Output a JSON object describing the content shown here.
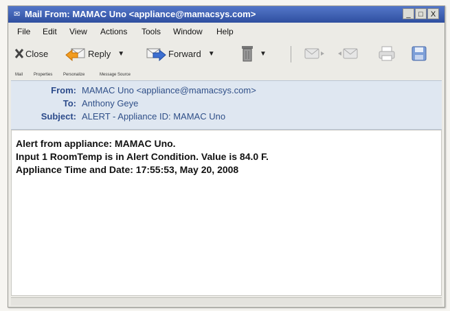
{
  "window": {
    "title": "Mail From: MAMAC Uno <appliance@mamacsys.com>"
  },
  "window_controls": {
    "minimize": "_",
    "maximize": "□",
    "close": "X"
  },
  "menu": [
    "File",
    "Edit",
    "View",
    "Actions",
    "Tools",
    "Window",
    "Help"
  ],
  "toolbar": {
    "close_label": "Close",
    "reply_label": "Reply",
    "forward_label": "Forward"
  },
  "tabs": [
    "Mail",
    "Properties",
    "Personalize",
    "Message Source"
  ],
  "header": {
    "from_label": "From:",
    "from_value": "MAMAC Uno <appliance@mamacsys.com>",
    "to_label": "To:",
    "to_value": "Anthony Geye",
    "subject_label": "Subject:",
    "subject_value": "ALERT - Appliance ID: MAMAC Uno"
  },
  "body": {
    "lines": [
      "Alert from appliance: MAMAC Uno.",
      "Input 1 RoomTemp is in Alert Condition. Value is 84.0 F.",
      "Appliance Time and Date: 17:55:53, May 20, 2008"
    ]
  },
  "colors": {
    "titlebar": "#3b5cb0",
    "header_bg": "#dfe7f1",
    "label": "#2b4a8a"
  }
}
